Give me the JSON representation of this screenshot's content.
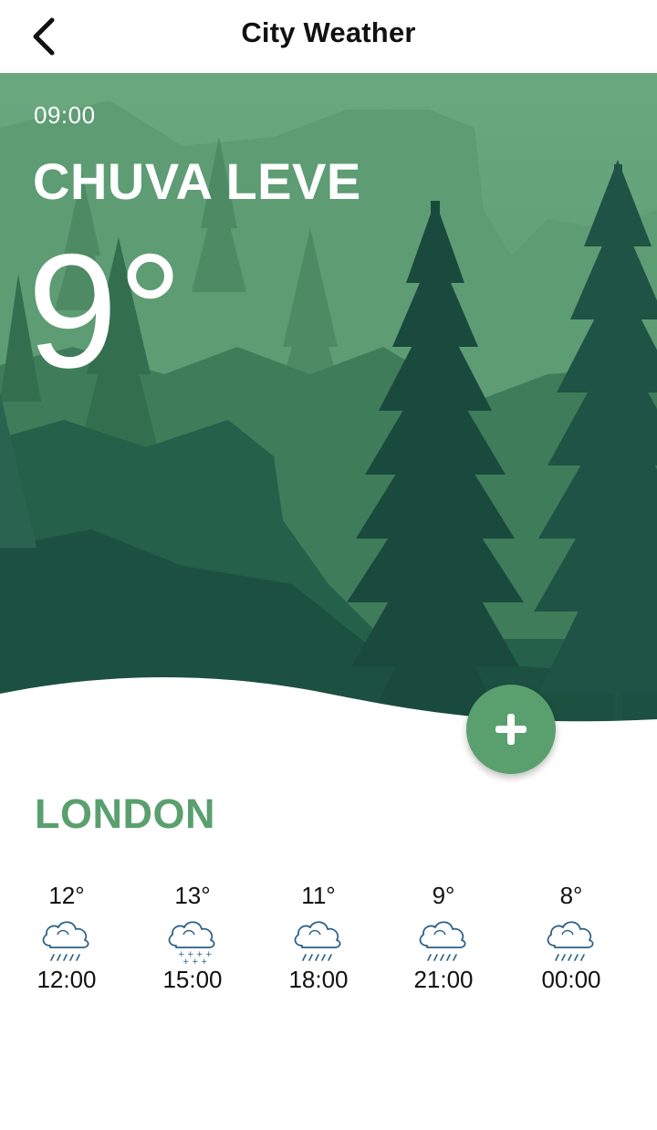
{
  "header": {
    "title": "City Weather",
    "back_icon": "chevron-left-icon"
  },
  "current": {
    "time": "09:00",
    "condition": "CHUVA LEVE",
    "temperature": "9°"
  },
  "add_button": {
    "icon": "plus-icon"
  },
  "city": {
    "name": "LONDON"
  },
  "forecast": [
    {
      "temp": "12°",
      "time": "12:00",
      "icon": "cloud-rain-icon"
    },
    {
      "temp": "13°",
      "time": "15:00",
      "icon": "cloud-snow-icon"
    },
    {
      "temp": "11°",
      "time": "18:00",
      "icon": "cloud-rain-icon"
    },
    {
      "temp": "9°",
      "time": "21:00",
      "icon": "cloud-rain-icon"
    },
    {
      "temp": "8°",
      "time": "00:00",
      "icon": "cloud-rain-icon"
    }
  ],
  "colors": {
    "accent": "#5aa06e",
    "forest_dark": "#123f35",
    "forest_light": "#5a9a72"
  }
}
